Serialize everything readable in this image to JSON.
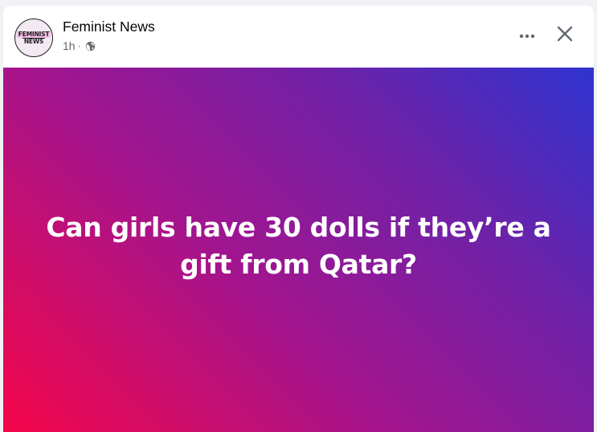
{
  "post": {
    "page_name": "Feminist News",
    "timestamp": "1h",
    "separator": "·",
    "visibility_icon": "globe-icon",
    "avatar": {
      "logo_line_1": "FEMINIST",
      "logo_line_2": "NEWS"
    },
    "text": "Can girls have 30 dolls if they’re a gift from Qatar?",
    "background_gradient": [
      "#f5064a",
      "#a1158f",
      "#6d22a8",
      "#2e33d0"
    ]
  },
  "header_actions": {
    "more_icon": "more-options-icon",
    "close_icon": "close-icon"
  },
  "colors": {
    "name_text": "#050505",
    "meta_text": "#65676b",
    "post_text": "#ffffff"
  }
}
